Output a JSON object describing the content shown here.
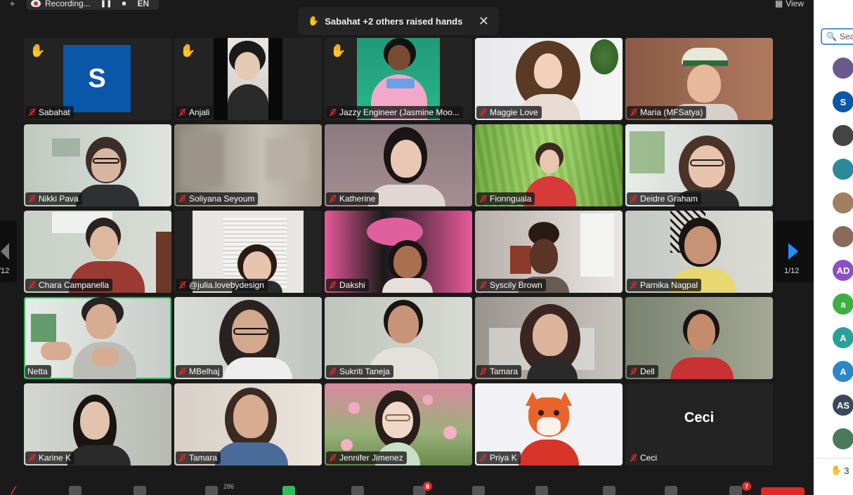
{
  "topbar": {
    "recording_label": "Recording...",
    "pause_icon": "pause-icon",
    "stop_icon": "stop-icon",
    "language": "EN",
    "view_label": "View"
  },
  "toast": {
    "hand_emoji": "✋",
    "message": "Sabahat +2 others raised hands",
    "close_glyph": "✕"
  },
  "pagination": {
    "left_label": "/12",
    "right_label": "1/12"
  },
  "participants": [
    {
      "name": "Sabahat",
      "hand": true,
      "type": "avatar",
      "initial": "S"
    },
    {
      "name": "Anjali",
      "hand": true,
      "type": "video"
    },
    {
      "name": "Jazzy Engineer (Jasmine Moo...",
      "hand": true,
      "type": "video"
    },
    {
      "name": "Maggie Love",
      "hand": false,
      "type": "video"
    },
    {
      "name": "Maria (MFSatya)",
      "hand": false,
      "type": "video"
    },
    {
      "name": "Nikki Pava",
      "hand": false,
      "type": "video"
    },
    {
      "name": "Soliyana Seyoum",
      "hand": false,
      "type": "video"
    },
    {
      "name": "Katherine",
      "hand": false,
      "type": "video"
    },
    {
      "name": "Fionnguala",
      "hand": false,
      "type": "video"
    },
    {
      "name": "Deidre Graham",
      "hand": false,
      "type": "video"
    },
    {
      "name": "Chara Campanella",
      "hand": false,
      "type": "video"
    },
    {
      "name": "@julia.lovebydesign",
      "hand": false,
      "type": "video"
    },
    {
      "name": "Dakshi",
      "hand": false,
      "type": "video"
    },
    {
      "name": "Syscily Brown",
      "hand": false,
      "type": "video"
    },
    {
      "name": "Parnika Nagpal",
      "hand": false,
      "type": "video"
    },
    {
      "name": "Netta",
      "hand": false,
      "type": "video",
      "speaking": true
    },
    {
      "name": "MBelhaj",
      "hand": false,
      "type": "video"
    },
    {
      "name": "Sukriti Taneja",
      "hand": false,
      "type": "video"
    },
    {
      "name": "Tamara",
      "hand": false,
      "type": "video"
    },
    {
      "name": "Dell",
      "hand": false,
      "type": "video"
    },
    {
      "name": "Karine K",
      "hand": false,
      "type": "video"
    },
    {
      "name": "Tamara",
      "hand": false,
      "type": "video"
    },
    {
      "name": "Jennifer Jimenez",
      "hand": false,
      "type": "video"
    },
    {
      "name": "Priya K",
      "hand": false,
      "type": "video"
    },
    {
      "name": "Ceci",
      "hand": false,
      "type": "name-only",
      "display": "Ceci"
    }
  ],
  "toolbar": {
    "participants_count": "286",
    "chat_badge": "8",
    "more_badge": "7"
  },
  "panel": {
    "search_placeholder": "Sea",
    "avatars": [
      {
        "initials": "",
        "color": "#6a5a8c"
      },
      {
        "initials": "S",
        "color": "#0a56a8"
      },
      {
        "initials": "",
        "color": "#444444"
      },
      {
        "initials": "",
        "color": "#2a8a9a"
      },
      {
        "initials": "",
        "color": "#a08060"
      },
      {
        "initials": "",
        "color": "#8a6a5a"
      },
      {
        "initials": "AD",
        "color": "#8c4fc9"
      },
      {
        "initials": "a",
        "color": "#3cb043"
      },
      {
        "initials": "A",
        "color": "#2aa198"
      },
      {
        "initials": "A",
        "color": "#2a87c8"
      },
      {
        "initials": "AS",
        "color": "#3a4a5c"
      },
      {
        "initials": "",
        "color": "#4a7a5a"
      }
    ],
    "raised_hands_count": "3",
    "hand_emoji": "✋"
  }
}
